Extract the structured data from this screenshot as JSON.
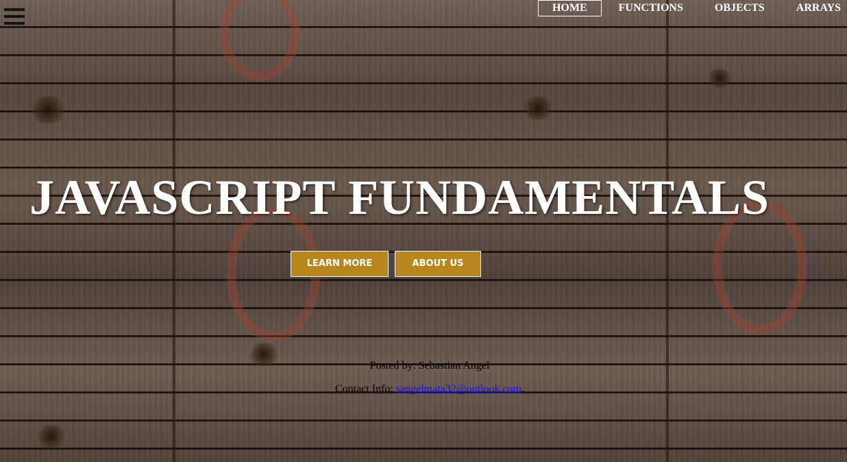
{
  "nav": {
    "items": [
      {
        "label": "HOME",
        "active": true
      },
      {
        "label": "FUNCTIONS",
        "active": false
      },
      {
        "label": "OBJECTS",
        "active": false
      },
      {
        "label": "ARRAYS",
        "active": false
      }
    ]
  },
  "menu": {
    "icon": "hamburger-menu-icon"
  },
  "hero": {
    "title": "JAVASCRIPT FUNDAMENTALS",
    "buttons": {
      "learn_more": "LEARN MORE",
      "about_us": "ABOUT US"
    }
  },
  "footer": {
    "posted_by": "Posted by: Sebastian Angel",
    "contact_prefix": "Contact Info: ",
    "contact_email": "sangelmata32@outlook.com",
    "contact_suffix": "."
  },
  "colors": {
    "button_bg": "#b8861e",
    "text_white": "#ffffff",
    "link": "#1a10ee"
  }
}
